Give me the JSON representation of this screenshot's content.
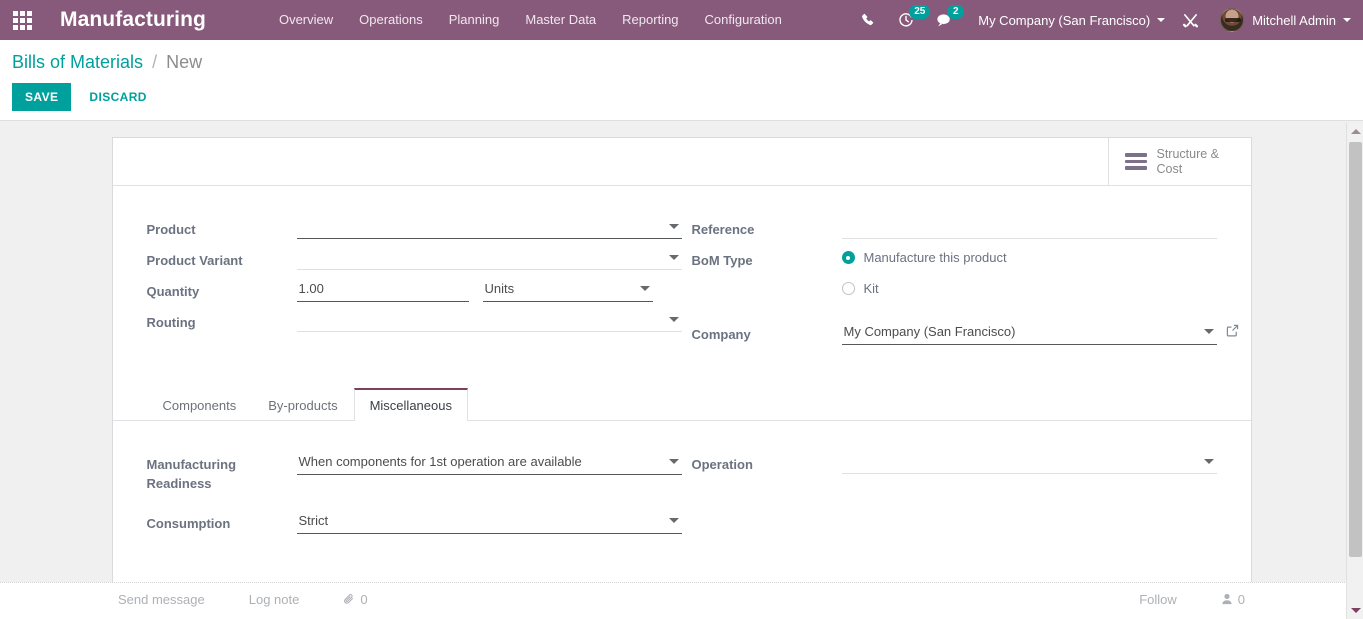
{
  "navbar": {
    "apps_icon": "apps-grid-icon",
    "brand": "Manufacturing",
    "menu": [
      {
        "label": "Overview"
      },
      {
        "label": "Operations"
      },
      {
        "label": "Planning"
      },
      {
        "label": "Master Data"
      },
      {
        "label": "Reporting"
      },
      {
        "label": "Configuration"
      }
    ],
    "phone_icon": "phone-icon",
    "activity_icon": "clock-activity-icon",
    "activity_count": "25",
    "messages_icon": "chat-bubble-icon",
    "messages_count": "2",
    "company": "My Company (San Francisco)",
    "debug_icon": "developer-tools-icon",
    "user": "Mitchell Admin",
    "brand_color": "#875A7B",
    "badge_color": "#00A09D"
  },
  "control_panel": {
    "breadcrumb_root": "Bills of Materials",
    "breadcrumb_sep": "/",
    "breadcrumb_current": "New",
    "save_label": "SAVE",
    "discard_label": "DISCARD",
    "accent_color": "#00A09D"
  },
  "sheet": {
    "stat_button": {
      "icon": "list-bars-icon",
      "label": "Structure & Cost"
    },
    "fields_left": [
      {
        "label": "Product",
        "value": "",
        "widget": "dropdown",
        "state": "required"
      },
      {
        "label": "Product Variant",
        "value": "",
        "widget": "dropdown",
        "state": "empty"
      },
      {
        "label": "Quantity",
        "value": "1.00",
        "uom": "Units",
        "widget": "qty",
        "state": "filled"
      },
      {
        "label": "Routing",
        "value": "",
        "widget": "dropdown",
        "state": "empty"
      }
    ],
    "fields_right": {
      "reference": {
        "label": "Reference",
        "value": ""
      },
      "bom_type": {
        "label": "BoM Type",
        "options": [
          {
            "label": "Manufacture this product",
            "selected": true
          },
          {
            "label": "Kit",
            "selected": false
          }
        ]
      },
      "company": {
        "label": "Company",
        "value": "My Company (San Francisco)",
        "external_link_icon": "external-link-icon"
      }
    },
    "tabs": [
      {
        "label": "Components",
        "active": false
      },
      {
        "label": "By-products",
        "active": false
      },
      {
        "label": "Miscellaneous",
        "active": true
      }
    ],
    "tab_content": {
      "left": [
        {
          "label": "Manufacturing Readiness",
          "value": "When components for 1st operation are available"
        },
        {
          "label": "Consumption",
          "value": "Strict"
        }
      ],
      "right": [
        {
          "label": "Operation",
          "value": ""
        }
      ]
    }
  },
  "chatter": {
    "send_message": "Send message",
    "log_note": "Log note",
    "attachment_icon": "paperclip-icon",
    "attachment_count": "0",
    "follow": "Follow",
    "followers_icon": "user-icon",
    "followers_count": "0"
  }
}
